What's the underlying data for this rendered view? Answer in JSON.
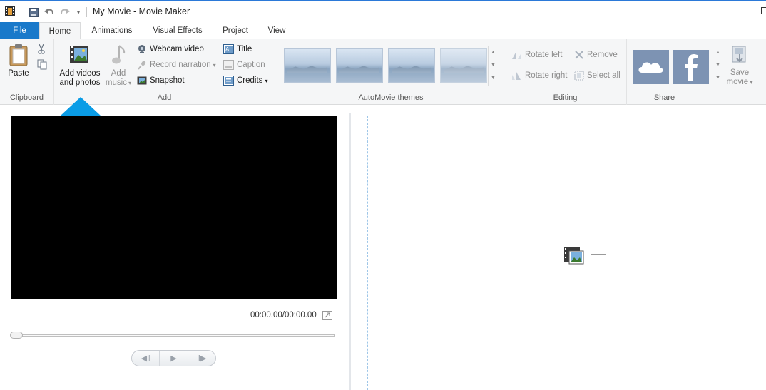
{
  "window": {
    "title": "My Movie - Movie Maker"
  },
  "tabs": [
    "File",
    "Home",
    "Animations",
    "Visual Effects",
    "Project",
    "View"
  ],
  "ribbon": {
    "clipboard": {
      "label": "Clipboard",
      "paste": "Paste"
    },
    "add": {
      "label": "Add",
      "add_videos_line1": "Add videos",
      "add_videos_line2": "and photos",
      "add_music_line1": "Add",
      "add_music_line2": "music",
      "webcam": "Webcam video",
      "record": "Record narration",
      "snapshot": "Snapshot",
      "title": "Title",
      "caption": "Caption",
      "credits": "Credits"
    },
    "themes": {
      "label": "AutoMovie themes"
    },
    "editing": {
      "label": "Editing",
      "rotate_left": "Rotate left",
      "rotate_right": "Rotate right",
      "remove": "Remove",
      "select_all": "Select all"
    },
    "share": {
      "label": "Share",
      "save_line1": "Save",
      "save_line2": "movie"
    }
  },
  "preview": {
    "time": "00:00.00/00:00.00"
  },
  "colors": {
    "accent": "#1979ca",
    "arrow": "#0a9ce6"
  }
}
